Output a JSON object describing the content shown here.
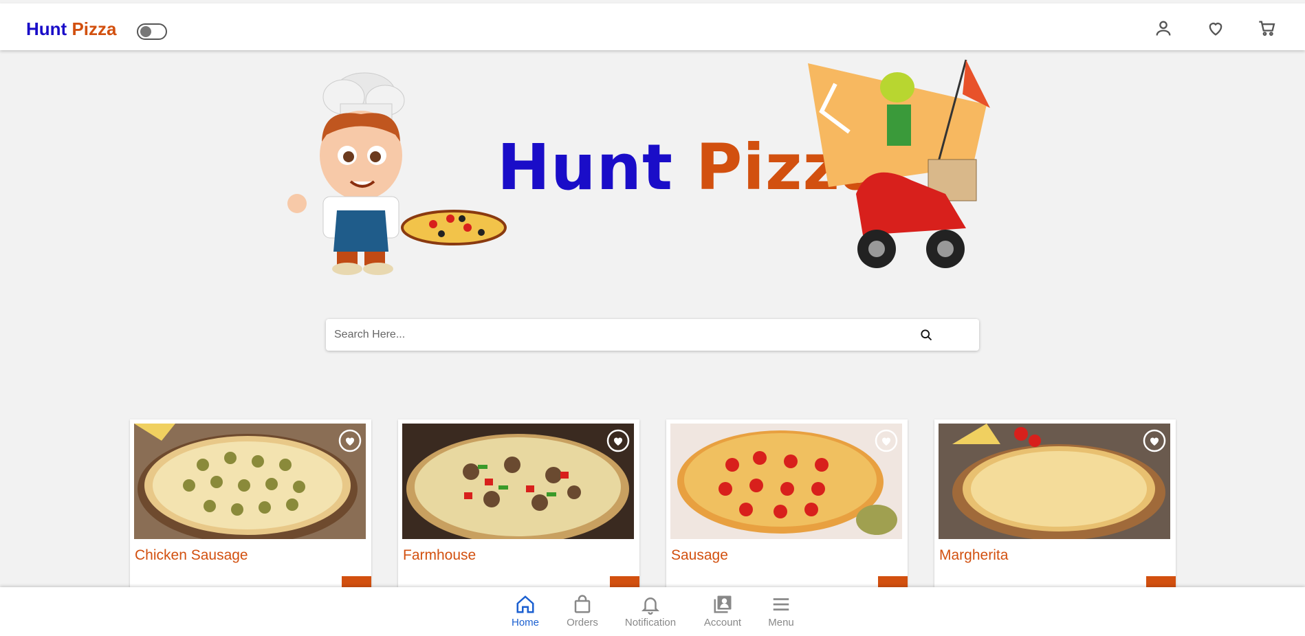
{
  "header": {
    "brand_part1": "Hunt",
    "brand_part2": "Pizza",
    "dark_mode_toggle": false
  },
  "hero": {
    "title_part1": "Hunt",
    "title_part2": "Pizza"
  },
  "search": {
    "placeholder": "Search Here..."
  },
  "products": [
    {
      "name": "Chicken Sausage"
    },
    {
      "name": "Farmhouse"
    },
    {
      "name": "Sausage"
    },
    {
      "name": "Margherita"
    }
  ],
  "bottom_nav": {
    "items": [
      {
        "label": "Home",
        "icon": "home-icon",
        "active": true
      },
      {
        "label": "Orders",
        "icon": "bag-icon",
        "active": false
      },
      {
        "label": "Notification",
        "icon": "bell-icon",
        "active": false
      },
      {
        "label": "Account",
        "icon": "account-icon",
        "active": false
      },
      {
        "label": "Menu",
        "icon": "menu-icon",
        "active": false
      }
    ]
  },
  "colors": {
    "brand_blue": "#1a0dc8",
    "brand_orange": "#d2500f",
    "active_nav": "#1a5fd0"
  }
}
